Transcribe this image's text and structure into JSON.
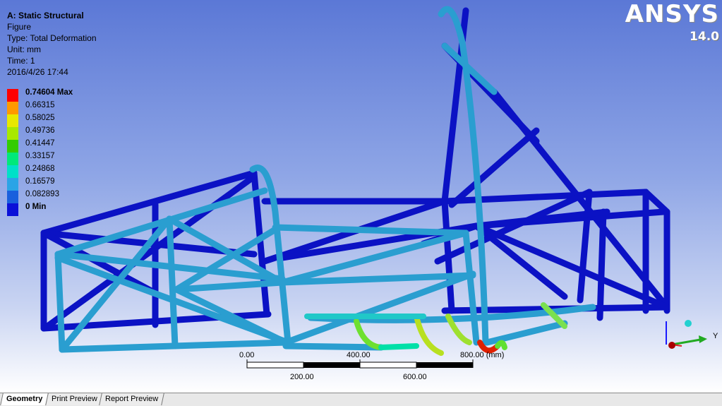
{
  "info": {
    "title": "A: Static Structural",
    "lines": [
      "Figure",
      "Type: Total Deformation",
      "Unit: mm",
      "Time: 1",
      "2016/4/26 17:44"
    ]
  },
  "legend": {
    "entries": [
      {
        "label": "0.74604 Max",
        "color": "#ff0000",
        "bold": true
      },
      {
        "label": "0.66315",
        "color": "#ff9900",
        "bold": false
      },
      {
        "label": "0.58025",
        "color": "#e8e800",
        "bold": false
      },
      {
        "label": "0.49736",
        "color": "#a8e800",
        "bold": false
      },
      {
        "label": "0.41447",
        "color": "#33cc00",
        "bold": false
      },
      {
        "label": "0.33157",
        "color": "#00e87a",
        "bold": false
      },
      {
        "label": "0.24868",
        "color": "#00e0c8",
        "bold": false
      },
      {
        "label": "0.16579",
        "color": "#2aa4e6",
        "bold": false
      },
      {
        "label": "0.082893",
        "color": "#1960dd",
        "bold": false
      },
      {
        "label": "0 Min",
        "color": "#0a10d8",
        "bold": true
      }
    ]
  },
  "logo": {
    "brand": "ANSYS",
    "version": "14.0"
  },
  "scale": {
    "top_labels": [
      "0.00",
      "400.00",
      "800.00 (mm)"
    ],
    "bottom_labels": [
      "200.00",
      "600.00"
    ]
  },
  "triad": {
    "y_label": "Y"
  },
  "tabs": [
    {
      "label": "Geometry",
      "active": true
    },
    {
      "label": "Print Preview",
      "active": false
    },
    {
      "label": "Report Preview",
      "active": false
    }
  ],
  "colors": {
    "min": "#0a10c8",
    "low": "#2aa4d6",
    "mid": "#00e0b0",
    "high": "#9ee000",
    "max": "#e02000"
  }
}
